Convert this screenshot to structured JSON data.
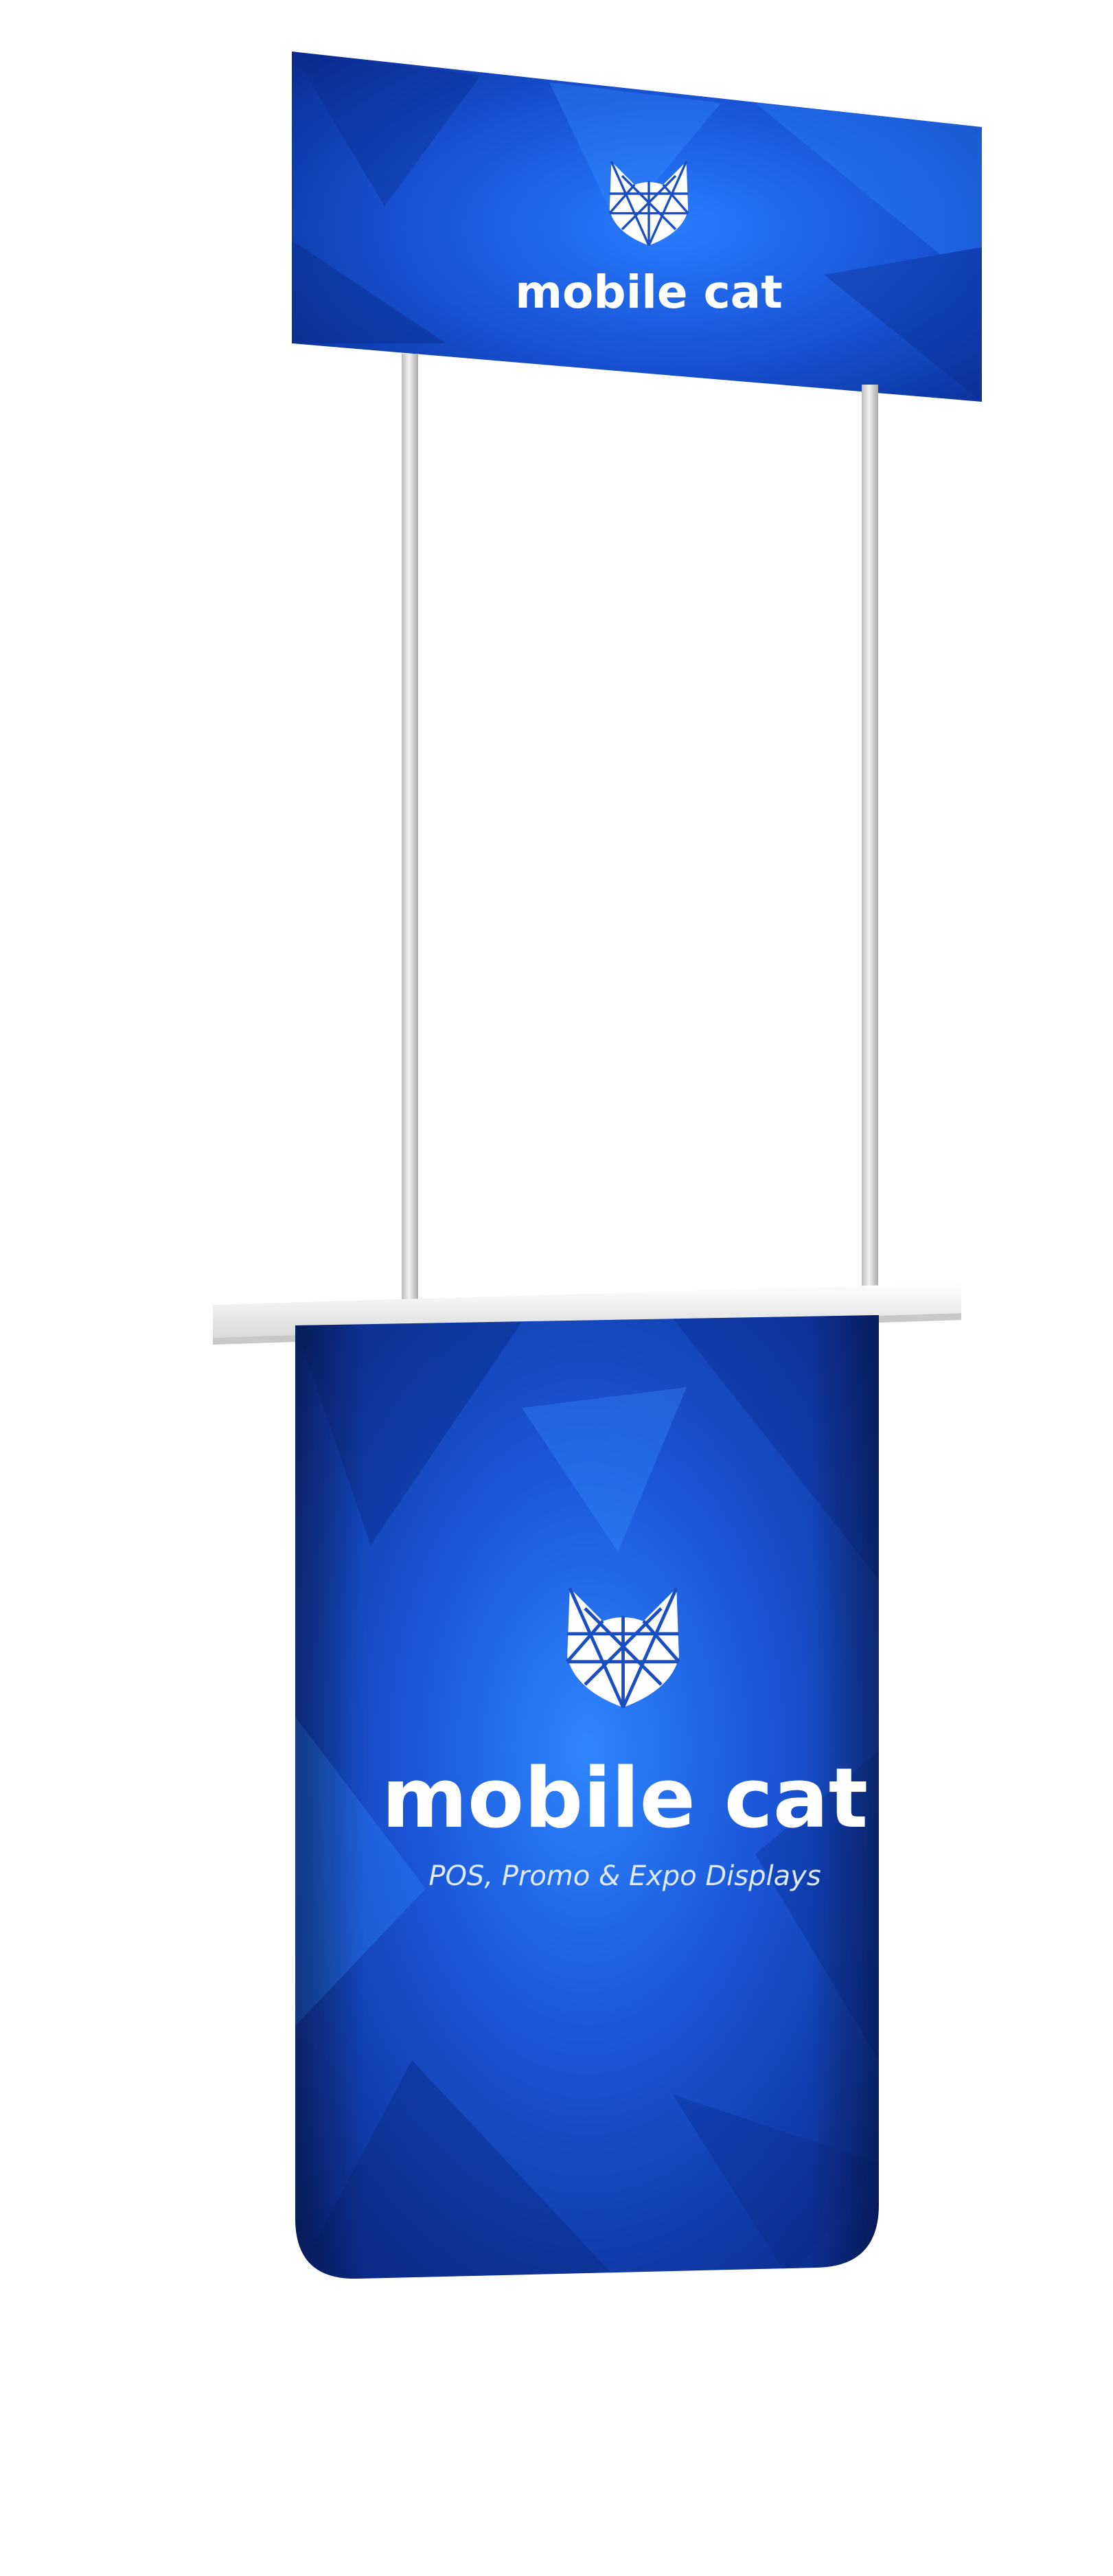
{
  "header_banner": {
    "brand_name": "mobile cat",
    "logo_icon": "cat-head-icon"
  },
  "counter_panel": {
    "brand_name": "mobile cat",
    "tagline": "POS, Promo & Expo Displays",
    "logo_icon": "cat-head-icon"
  },
  "colors": {
    "background": "#ffffff",
    "banner_blue": "#1a4fc4",
    "banner_blue_light": "#2f7bff",
    "banner_blue_dark": "#0d2e8c",
    "pole_gray": "#d8d8d8",
    "countertop_white": "#f5f5f5",
    "text_white": "#ffffff"
  }
}
